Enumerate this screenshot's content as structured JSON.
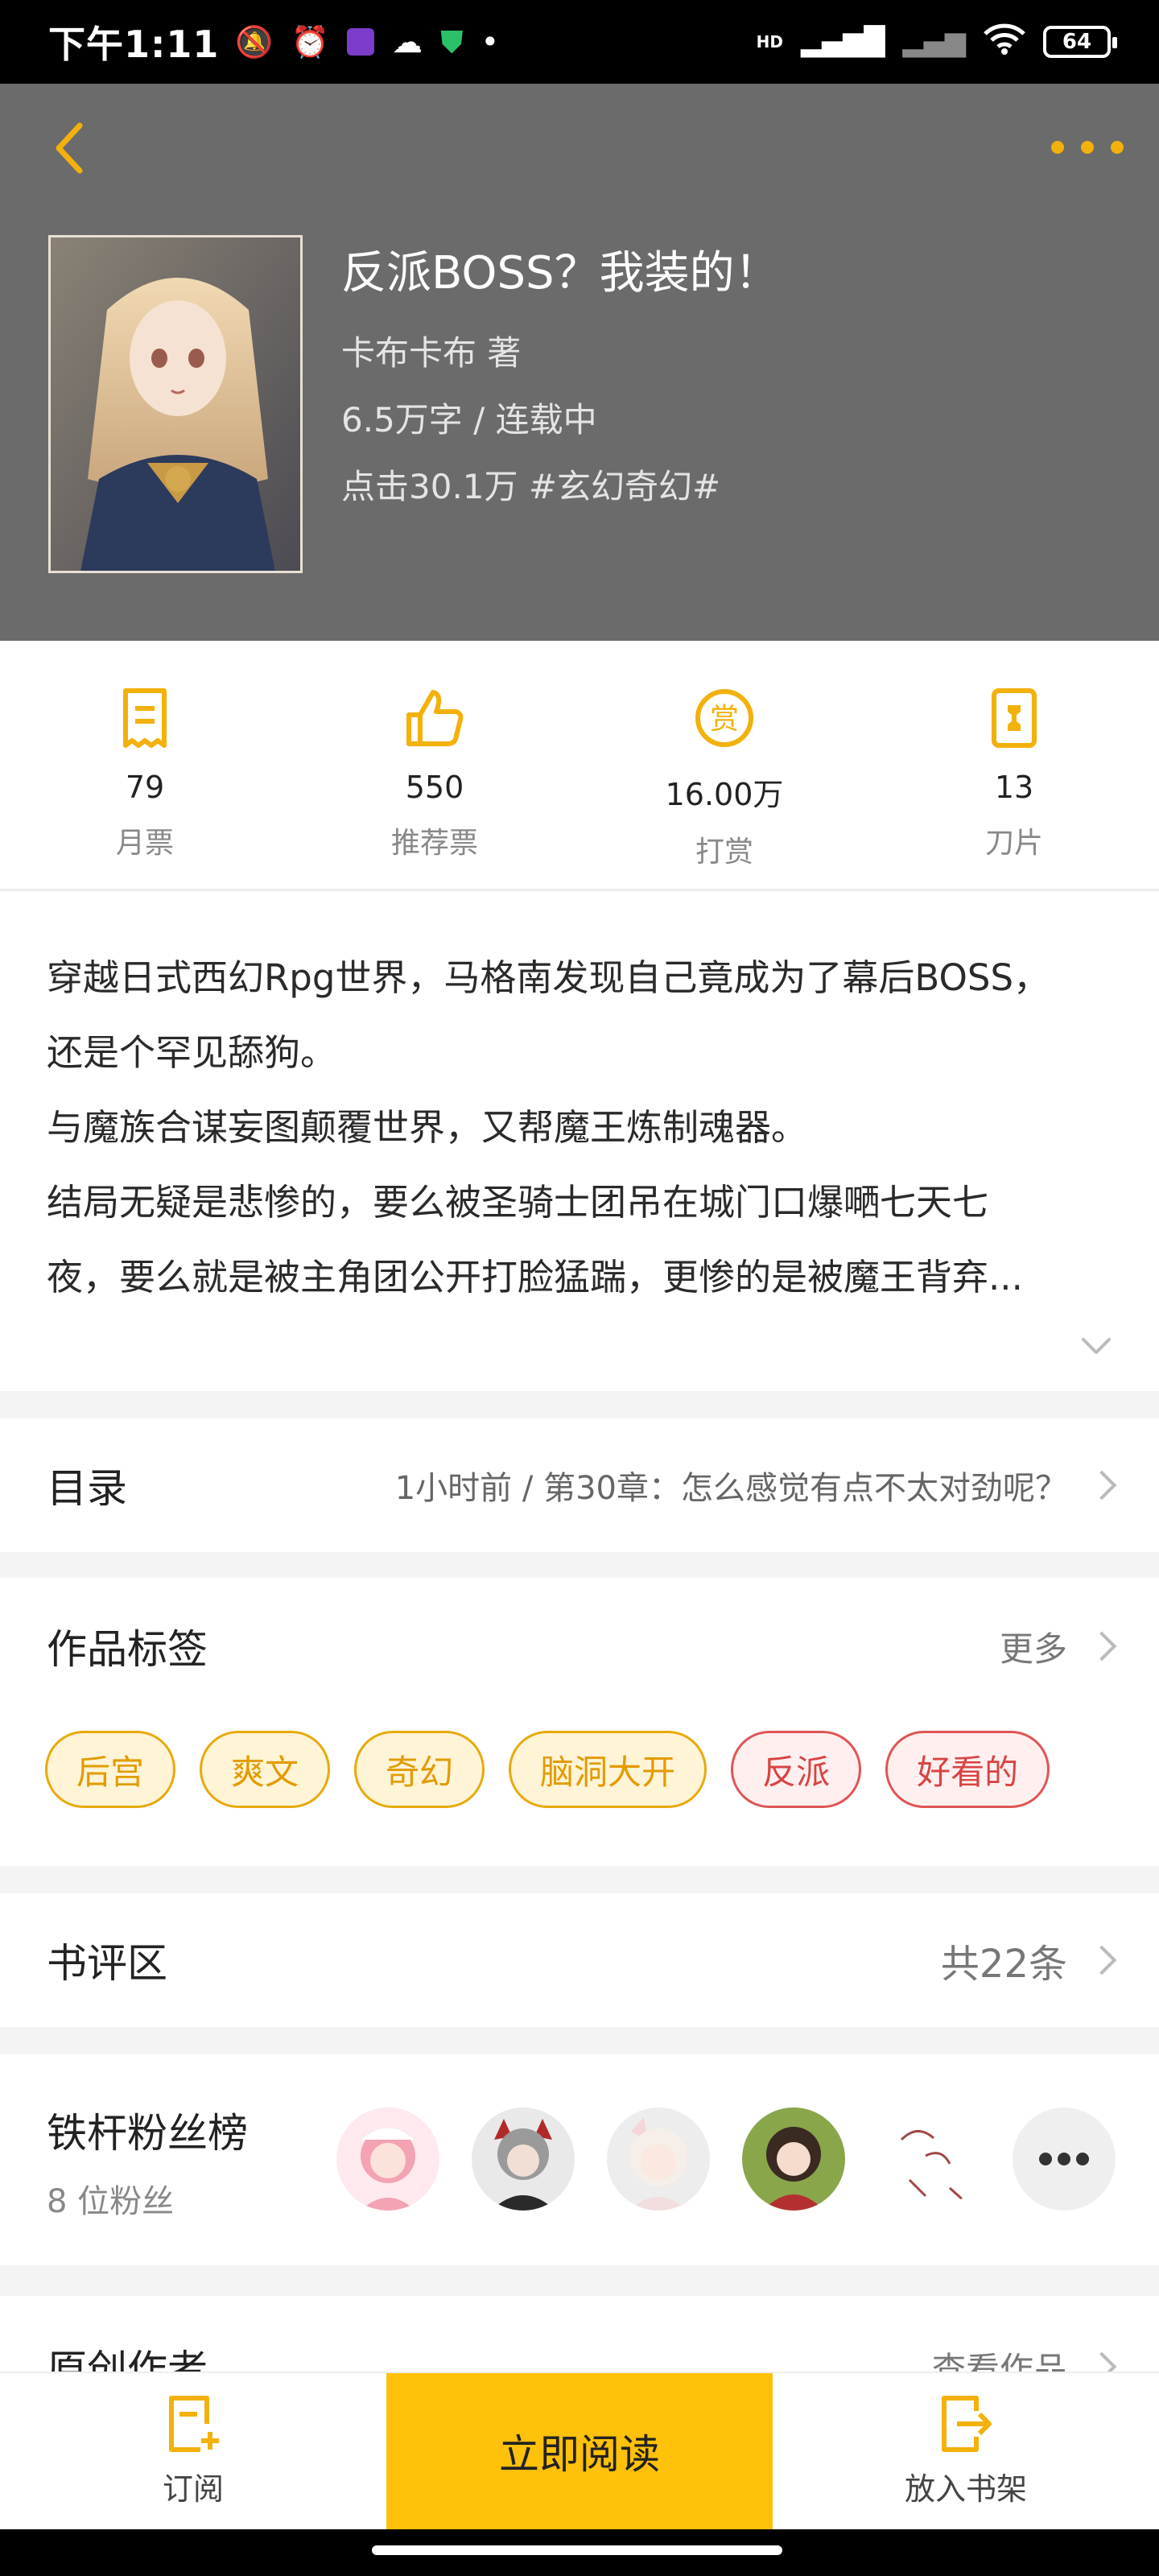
{
  "status_bar": {
    "time": "下午1:11",
    "battery": "64",
    "network": "HD"
  },
  "book": {
    "title": "反派BOSS？我装的！",
    "author_line": "卡布卡布  著",
    "words_line": "6.5万字 / 连载中",
    "clicks_line": "点击30.1万  #玄幻奇幻#"
  },
  "stats": [
    {
      "value": "79",
      "label": "月票",
      "icon": "ticket-icon"
    },
    {
      "value": "550",
      "label": "推荐票",
      "icon": "thumbs-up-icon"
    },
    {
      "value": "16.00万",
      "label": "打赏",
      "icon": "reward-coin-icon"
    },
    {
      "value": "13",
      "label": "刀片",
      "icon": "blade-icon"
    }
  ],
  "description": [
    "穿越日式西幻Rpg世界，马格南发现自己竟成为了幕后BOSS，",
    "还是个罕见舔狗。",
    "与魔族合谋妄图颠覆世界，又帮魔王炼制魂器。",
    "结局无疑是悲惨的，要么被圣骑士团吊在城门口爆嗮七天七",
    "夜，要么就是被主角团公开打脸猛踹，更惨的是被魔王背弃..."
  ],
  "catalog": {
    "title": "目录",
    "latest": "1小时前 / 第30章：怎么感觉有点不太对劲呢？"
  },
  "tags_section": {
    "title": "作品标签",
    "more": "更多",
    "tags": [
      {
        "label": "后宫",
        "color": "yellow"
      },
      {
        "label": "爽文",
        "color": "yellow"
      },
      {
        "label": "奇幻",
        "color": "yellow"
      },
      {
        "label": "脑洞大开",
        "color": "yellow"
      },
      {
        "label": "反派",
        "color": "red"
      },
      {
        "label": "好看的",
        "color": "red"
      }
    ]
  },
  "reviews": {
    "title": "书评区",
    "count": "共22条"
  },
  "fans": {
    "title": "铁杆粉丝榜",
    "count": "8 位粉丝"
  },
  "original_author": {
    "title": "原创作者",
    "link": "查看作品"
  },
  "bottom_bar": {
    "subscribe": "订阅",
    "read_now": "立即阅读",
    "add_shelf": "放入书架"
  },
  "colors": {
    "accent": "#ffc109",
    "header_bg": "#6b6b6b",
    "icon_gold": "#f2b10b",
    "tag_red": "#d84443"
  }
}
